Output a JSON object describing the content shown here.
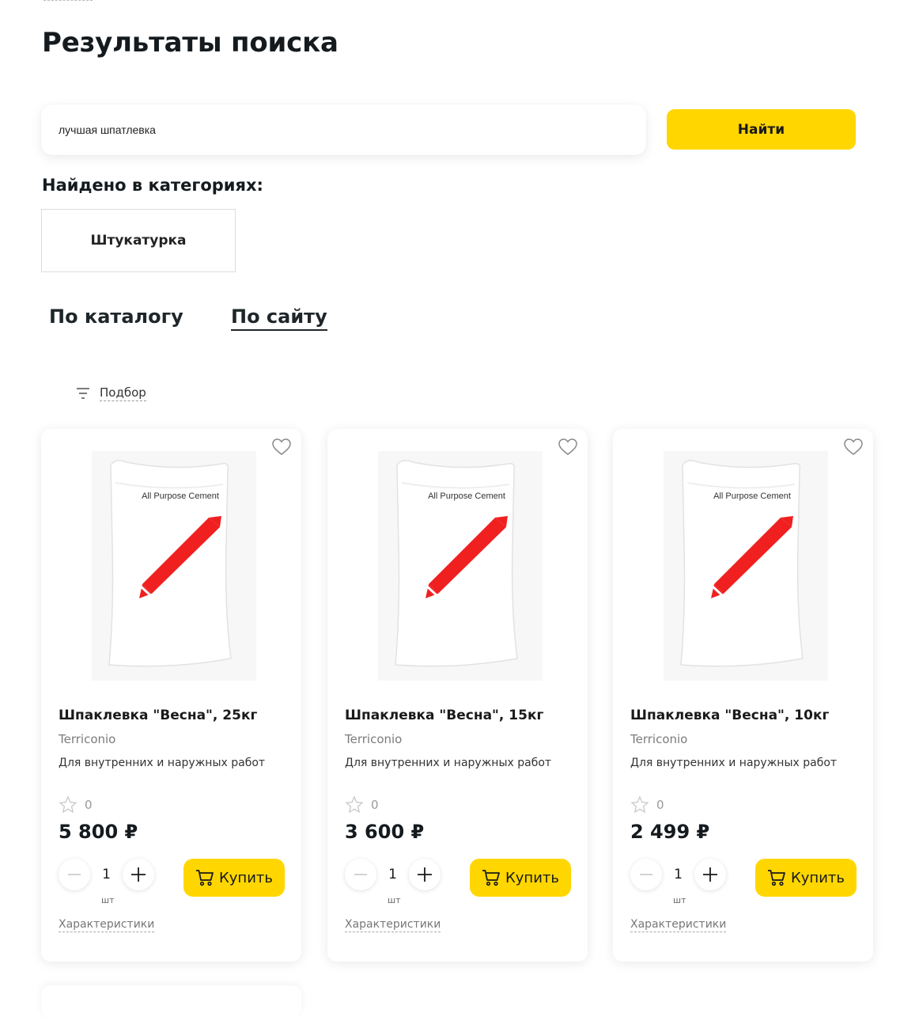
{
  "page": {
    "title": "Результаты поиска"
  },
  "search": {
    "value": "лучшая шпатлевка",
    "button_label": "Найти"
  },
  "categories": {
    "heading": "Найдено в категориях:",
    "items": [
      {
        "label": "Штукатурка"
      }
    ]
  },
  "tabs": [
    {
      "label": "По каталогу",
      "active": false
    },
    {
      "label": "По сайту",
      "active": true
    }
  ],
  "filter": {
    "label": "Подбор",
    "icon": "filter-icon"
  },
  "products": [
    {
      "name": "Шпаклевка \"Весна\", 25кг",
      "brand": "Terriconio",
      "description": "Для внутренних и наружных работ",
      "rating_count": "0",
      "price": "5 800 ₽",
      "quantity": "1",
      "unit": "шт",
      "buy_label": "Купить",
      "specs_label": "Характеристики",
      "image_text": "All Purpose Cement"
    },
    {
      "name": "Шпаклевка \"Весна\", 15кг",
      "brand": "Terriconio",
      "description": "Для внутренних и наружных работ",
      "rating_count": "0",
      "price": "3 600 ₽",
      "quantity": "1",
      "unit": "шт",
      "buy_label": "Купить",
      "specs_label": "Характеристики",
      "image_text": "All Purpose Cement"
    },
    {
      "name": "Шпаклевка \"Весна\", 10кг",
      "brand": "Terriconio",
      "description": "Для внутренних и наружных работ",
      "rating_count": "0",
      "price": "2 499 ₽",
      "quantity": "1",
      "unit": "шт",
      "buy_label": "Купить",
      "specs_label": "Характеристики",
      "image_text": "All Purpose Cement"
    }
  ],
  "colors": {
    "accent": "#ffd600",
    "text_dark": "#141a1e",
    "muted": "#7b7b7b",
    "bag_stripe": "#f02020"
  }
}
